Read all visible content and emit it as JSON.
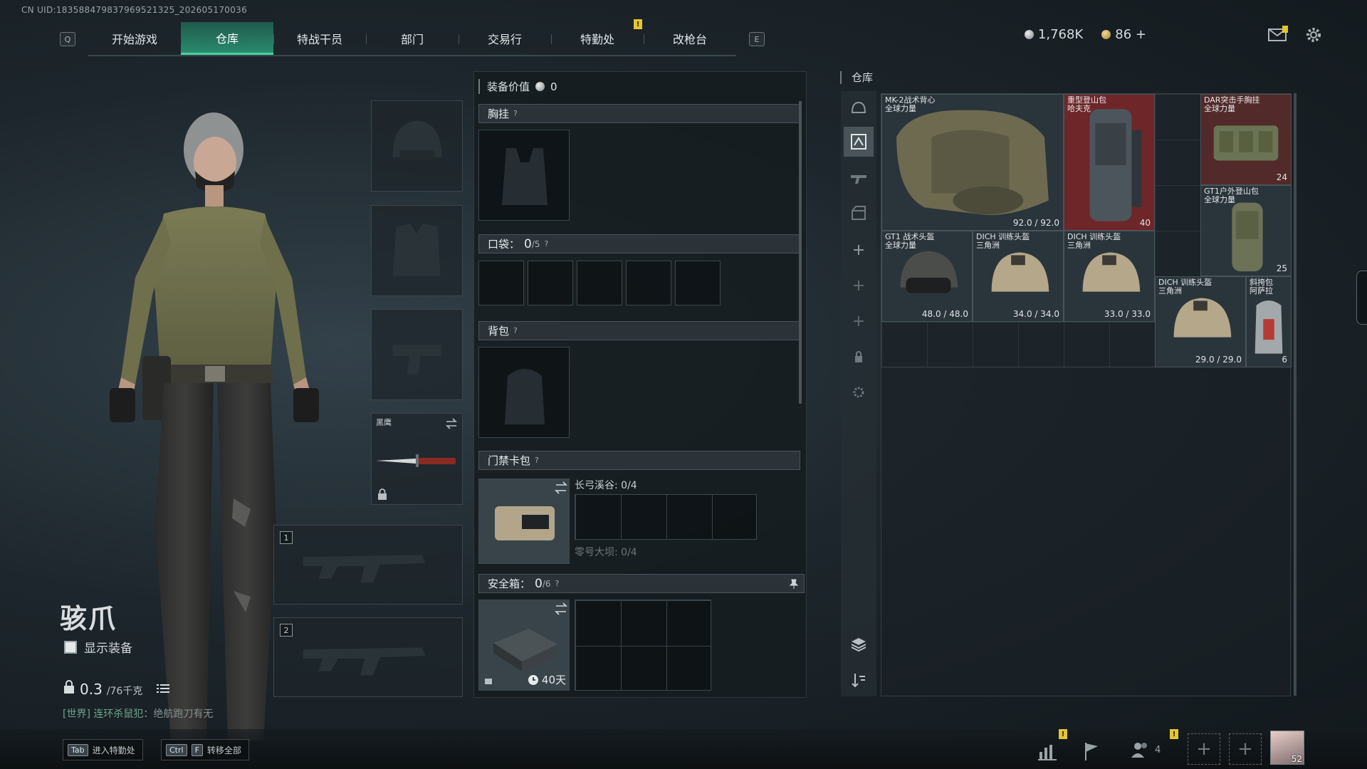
{
  "uid": "CN UID:18358847983796952132​5_202605170036",
  "nav": {
    "left_key": "Q",
    "right_key": "E",
    "tabs": [
      {
        "label": "开始游戏"
      },
      {
        "label": "仓库"
      },
      {
        "label": "特战干员"
      },
      {
        "label": "部门"
      },
      {
        "label": "交易行"
      },
      {
        "label": "特勤处"
      },
      {
        "label": "改枪台"
      }
    ],
    "alert": "!"
  },
  "currency": {
    "silver": "1,768K",
    "gold": "86",
    "gold_add": "+"
  },
  "operator": {
    "name": "骇爪",
    "show_equipment_label": "显示装备",
    "weight_value": "0.3",
    "weight_max": "/76千克"
  },
  "chat": {
    "channel": "[世界]",
    "sender": "连环杀鼠犯",
    "message": "：绝航跑刀有无"
  },
  "loadout": {
    "melee_name": "黑鹰",
    "primary_slot": "1",
    "secondary_slot": "2"
  },
  "equipment": {
    "title": "装备价值",
    "value": "0",
    "chest_rig": {
      "label": "胸挂",
      "help": "?"
    },
    "pockets": {
      "label": "口袋：",
      "count": "0",
      "max": "/5",
      "help": "?"
    },
    "backpack": {
      "label": "背包",
      "help": "?"
    },
    "keycard": {
      "label": "门禁卡包",
      "help": "?",
      "map1": "长弓溪谷: 0/4",
      "map2": "零号大坝: 0/4"
    },
    "safebox": {
      "label": "安全箱：",
      "count": "0",
      "max": "/6",
      "help": "?",
      "time": "40天"
    }
  },
  "warehouse": {
    "title": "仓库",
    "items": [
      {
        "name": "MK-2战术背心\n全球力量",
        "value": "92.0 / 92.0"
      },
      {
        "name": "重型登山包\n哈夫克",
        "value": "40"
      },
      {
        "name": "DAR突击手胸挂\n全球力量",
        "value": "24"
      },
      {
        "name": "GT1户外登山包\n全球力量",
        "value": "25"
      },
      {
        "name": "GT1 战术头盔\n全球力量",
        "value": "48.0 / 48.0"
      },
      {
        "name": "DICH 训练头盔\n三角洲",
        "value": "34.0 / 34.0"
      },
      {
        "name": "DICH 训练头盔\n三角洲",
        "value": "33.0 / 33.0"
      },
      {
        "name": "DICH 训练头盔\n三角洲",
        "value": "29.0 / 29.0"
      },
      {
        "name": "斜挎包\n阿萨拉",
        "value": "6"
      }
    ]
  },
  "bottom": {
    "hint1_key": "Tab",
    "hint1_label": "进入特勤处",
    "hint2_key1": "Ctrl",
    "hint2_key2": "F",
    "hint2_label": "转移全部",
    "friends_count": "4",
    "level": "52"
  },
  "colors": {
    "accent_green": "#49d1a1",
    "tab_active": "#2a8a6d",
    "alert_yellow": "#e5c531",
    "backpack_red": "#7a2a2c"
  }
}
